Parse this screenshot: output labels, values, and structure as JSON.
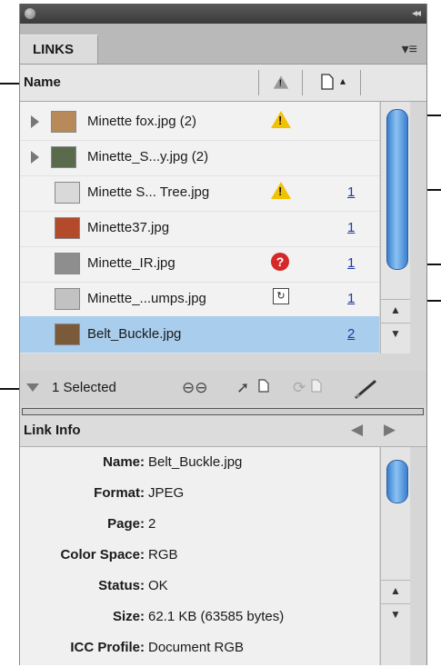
{
  "panel": {
    "tab_label": "LINKS",
    "collapse_glyph": "◂◂",
    "menu_glyph": "▾≡"
  },
  "header": {
    "name_label": "Name",
    "status_col_icon": "warning-icon",
    "page_col_icon": "page-icon",
    "sort_glyph": "▴"
  },
  "rows": [
    {
      "name": "Minette fox.jpg (2)",
      "expandable": true,
      "status": "warning",
      "page": "",
      "selected": false,
      "thumb_color": "#b88a5a"
    },
    {
      "name": "Minette_S...y.jpg (2)",
      "expandable": true,
      "status": "",
      "page": "",
      "selected": false,
      "thumb_color": "#5a6b4d"
    },
    {
      "name": "Minette S... Tree.jpg",
      "expandable": false,
      "status": "warning",
      "page": "1",
      "selected": false,
      "thumb_color": "#d9d9d9"
    },
    {
      "name": "Minette37.jpg",
      "expandable": false,
      "status": "",
      "page": "1",
      "selected": false,
      "thumb_color": "#b34a2c"
    },
    {
      "name": "Minette_IR.jpg",
      "expandable": false,
      "status": "missing",
      "page": "1",
      "selected": false,
      "thumb_color": "#8e8e8e"
    },
    {
      "name": "Minette_...umps.jpg",
      "expandable": false,
      "status": "modified",
      "page": "1",
      "selected": false,
      "thumb_color": "#c2c2c2"
    },
    {
      "name": "Belt_Buckle.jpg",
      "expandable": false,
      "status": "",
      "page": "2",
      "selected": true,
      "thumb_color": "#7b5a3a"
    }
  ],
  "status_glyphs": {
    "warning": "!",
    "missing": "?",
    "modified": "↻"
  },
  "footer": {
    "selected_text": "1 Selected"
  },
  "link_info": {
    "title": "Link Info",
    "fields": [
      {
        "key": "Name:",
        "value": "Belt_Buckle.jpg"
      },
      {
        "key": "Format:",
        "value": "JPEG"
      },
      {
        "key": "Page:",
        "value": "2"
      },
      {
        "key": "Color Space:",
        "value": "RGB"
      },
      {
        "key": "Status:",
        "value": "OK"
      },
      {
        "key": "Size:",
        "value": "62.1 KB (63585 bytes)"
      },
      {
        "key": "ICC Profile:",
        "value": "Document RGB"
      }
    ]
  },
  "colors": {
    "accent_scroll": "#3a7fd0",
    "selection": "#a9cdec",
    "link_page": "#1f3aa6",
    "warning": "#f2c200",
    "missing": "#d62828"
  }
}
